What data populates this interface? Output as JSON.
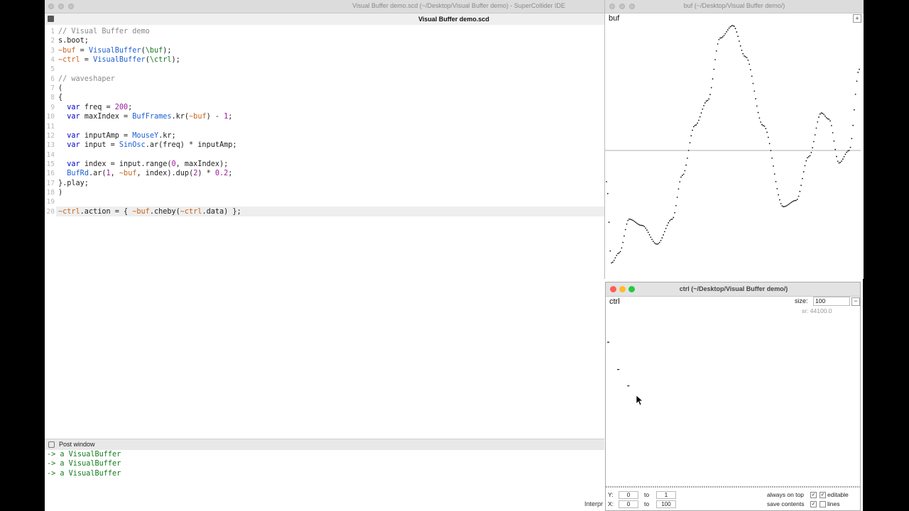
{
  "ide": {
    "title": "Visual Buffer demo.scd (~/Desktop/Visual Buffer demo) - SuperCollider IDE",
    "doc_tab": "Visual Buffer demo.scd",
    "code_lines": [
      {
        "n": "1",
        "text": "// Visual Buffer demo"
      },
      {
        "n": "2",
        "text": "s.boot;"
      },
      {
        "n": "3",
        "text": "~buf = VisualBuffer(\\buf);"
      },
      {
        "n": "4",
        "text": "~ctrl = VisualBuffer(\\ctrl);"
      },
      {
        "n": "5",
        "text": ""
      },
      {
        "n": "6",
        "text": "// waveshaper"
      },
      {
        "n": "7",
        "text": "("
      },
      {
        "n": "8",
        "text": "{"
      },
      {
        "n": "9",
        "text": "  var freq = 200;"
      },
      {
        "n": "10",
        "text": "  var maxIndex = BufFrames.kr(~buf) - 1;"
      },
      {
        "n": "11",
        "text": ""
      },
      {
        "n": "12",
        "text": "  var inputAmp = MouseY.kr;"
      },
      {
        "n": "13",
        "text": "  var input = SinOsc.ar(freq) * inputAmp;"
      },
      {
        "n": "14",
        "text": ""
      },
      {
        "n": "15",
        "text": "  var index = input.range(0, maxIndex);"
      },
      {
        "n": "16",
        "text": "  BufRd.ar(1, ~buf, index).dup(2) * 0.2;"
      },
      {
        "n": "17",
        "text": "}.play;"
      },
      {
        "n": "18",
        "text": ")"
      },
      {
        "n": "19",
        "text": ""
      },
      {
        "n": "20",
        "text": "~ctrl.action = { ~buf.cheby(~ctrl.data) };"
      }
    ],
    "current_line": "20",
    "post_window": {
      "title": "Post window",
      "lines": [
        "-> a VisualBuffer",
        "-> a VisualBuffer",
        "-> a VisualBuffer"
      ]
    },
    "status": "Interpr"
  },
  "buf_window": {
    "title": "buf  (~/Desktop/Visual Buffer demo/)",
    "name": "buf",
    "plus_label": "+"
  },
  "ctrl_window": {
    "title": "ctrl  (~/Desktop/Visual Buffer demo/)",
    "name": "ctrl",
    "size_label": "size:",
    "size_value": "100",
    "minus_label": "−",
    "sr_label": "sr: 44100.0",
    "footer": {
      "y_label": "Y:",
      "y_from": "0",
      "y_to_label": "to",
      "y_to": "1",
      "x_label": "X:",
      "x_from": "0",
      "x_to_label": "to",
      "x_to": "100",
      "always_on_top": "always on top",
      "editable": "editable",
      "save_contents": "save contents",
      "lines": "lines",
      "always_on_top_checked": true,
      "editable_checked": true,
      "save_contents_checked": true,
      "lines_checked": false
    }
  },
  "colors": {
    "keyword": "#0000c8",
    "comment": "#8a8a8a",
    "class": "#1c5fd1",
    "env_var": "#c8641c",
    "number": "#a0189a",
    "post_text": "#137a1a",
    "traffic_red": "#ff5f57",
    "traffic_yellow": "#febc2e",
    "traffic_green": "#28c840"
  },
  "chart_data": [
    {
      "type": "line",
      "name_ref": "buf waveform",
      "x": [
        0,
        0.02,
        0.05,
        0.09,
        0.14,
        0.2,
        0.26,
        0.3,
        0.35,
        0.4,
        0.45,
        0.5,
        0.55,
        0.62,
        0.7,
        0.75,
        0.8,
        0.85,
        0.88,
        0.92,
        0.96,
        1.0
      ],
      "values": [
        -0.25,
        -0.9,
        -0.82,
        -0.55,
        -0.6,
        -0.75,
        -0.55,
        -0.2,
        0.2,
        0.4,
        0.9,
        1.0,
        0.75,
        0.2,
        -0.45,
        -0.4,
        -0.05,
        0.3,
        0.25,
        -0.1,
        0.0,
        0.65
      ],
      "ylim": [
        -1,
        1
      ],
      "zero_line": true
    },
    {
      "type": "scatter",
      "name_ref": "ctrl data",
      "x": [
        0,
        4,
        8
      ],
      "values": [
        0.8,
        0.65,
        0.56
      ],
      "ylim": [
        0,
        1
      ],
      "xlim": [
        0,
        100
      ]
    }
  ]
}
